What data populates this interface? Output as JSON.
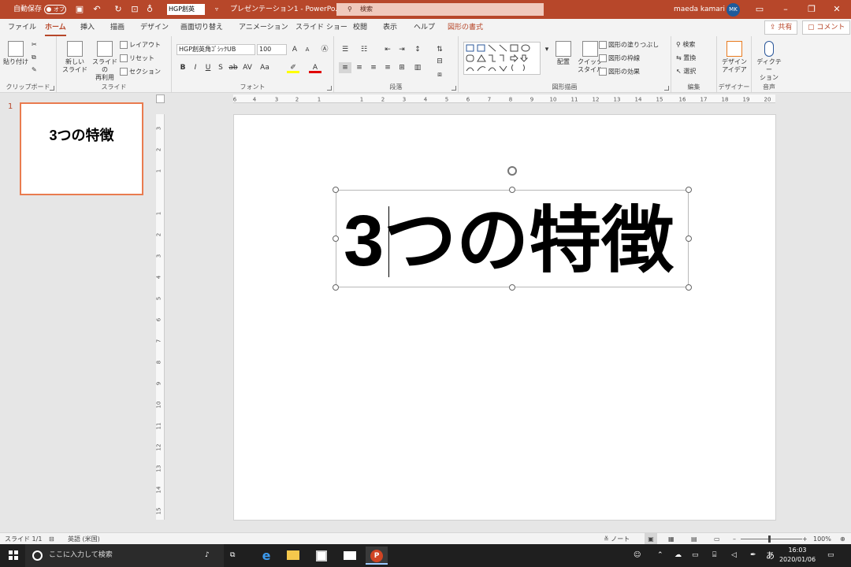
{
  "titlebar": {
    "autosave_label": "自動保存",
    "autosave_state": "オフ",
    "font_name": "HGP創英",
    "document_title": "プレゼンテーション1 - PowerPo...",
    "search_placeholder": "検索",
    "user_name": "maeda kamari",
    "user_initials": "MK"
  },
  "tabs": [
    "ファイル",
    "ホーム",
    "挿入",
    "描画",
    "デザイン",
    "画面切り替え",
    "アニメーション",
    "スライド ショー",
    "校閲",
    "表示",
    "ヘルプ",
    "図形の書式"
  ],
  "share_label": "共有",
  "comment_label": "コメント",
  "ribbon": {
    "clipboard": {
      "paste": "貼り付け",
      "group": "クリップボード"
    },
    "slides": {
      "new_slide": "新しい\nスライド",
      "reuse": "スライドの\n再利用",
      "layout": "レイアウト",
      "reset": "リセット",
      "section": "セクション",
      "group": "スライド"
    },
    "font": {
      "font_name": "HGP創英角ｺﾞｼｯｸUB",
      "font_size": "100",
      "group": "フォント"
    },
    "paragraph": {
      "group": "段落"
    },
    "drawing": {
      "arrange": "配置",
      "quick_styles": "クイック\nスタイル",
      "fill": "図形の塗りつぶし",
      "outline": "図形の枠線",
      "effects": "図形の効果",
      "group": "図形描画"
    },
    "editing": {
      "find": "検索",
      "replace": "置換",
      "select": "選択",
      "group": "編集"
    },
    "designer": {
      "design_ideas": "デザイン\nアイデア",
      "group": "デザイナー"
    },
    "voice": {
      "dictate": "ディクテー\nション",
      "group": "音声"
    }
  },
  "ruler": {
    "h_ticks": [
      "6",
      "4",
      "3",
      "2",
      "1",
      "1",
      "2",
      "3",
      "4",
      "5",
      "6",
      "7",
      "8",
      "9",
      "10",
      "11",
      "12",
      "13",
      "14",
      "15",
      "16",
      "17",
      "18",
      "19",
      "20"
    ],
    "v_ticks": [
      "3",
      "2",
      "1",
      "1",
      "2",
      "3",
      "4",
      "5",
      "6",
      "7",
      "8",
      "9",
      "10",
      "11",
      "12",
      "13",
      "14",
      "15"
    ]
  },
  "thumbnail": {
    "number": "1",
    "title": "3つの特徴"
  },
  "slide": {
    "title": "3つの特徴"
  },
  "status": {
    "slide_count": "スライド 1/1",
    "language": "英語 (米国)",
    "notes": "ノート",
    "zoom": "100%"
  },
  "taskbar": {
    "search_placeholder": "ここに入力して検索",
    "ime": "あ",
    "time": "16:03",
    "date": "2020/01/06"
  }
}
